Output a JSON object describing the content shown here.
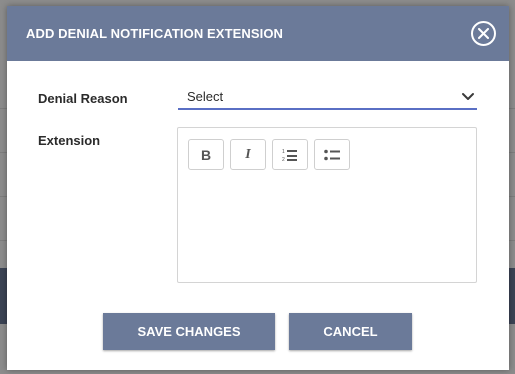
{
  "dialog": {
    "title": "ADD DENIAL NOTIFICATION EXTENSION",
    "close_icon": "close-circle-icon"
  },
  "form": {
    "denial_reason": {
      "label": "Denial Reason",
      "value": "Select",
      "icon": "chevron-down-icon"
    },
    "extension": {
      "label": "Extension",
      "toolbar": [
        {
          "name": "bold",
          "glyph": "B",
          "icon": "bold-icon"
        },
        {
          "name": "italic",
          "glyph": "I",
          "icon": "italic-icon"
        },
        {
          "name": "ordered-list",
          "icon": "ordered-list-icon"
        },
        {
          "name": "bullet-list",
          "icon": "bullet-list-icon"
        }
      ],
      "value": ""
    }
  },
  "actions": {
    "save_label": "SAVE CHANGES",
    "cancel_label": "CANCEL"
  },
  "colors": {
    "header": "#6b7a99",
    "button": "#6b7a99",
    "select_underline": "#5a6fc4",
    "backdrop": "#8c8c8c"
  }
}
